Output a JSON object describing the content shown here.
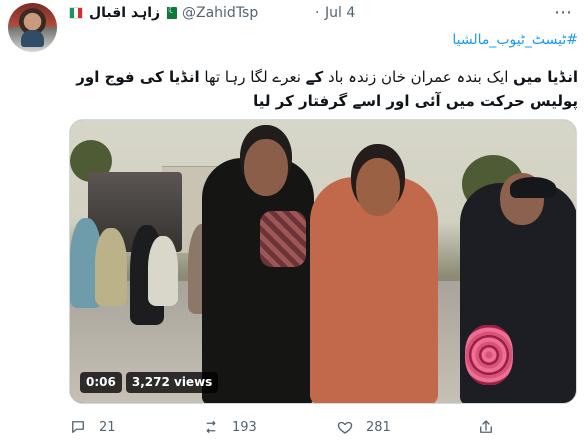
{
  "author": {
    "display_name": "زاہد اقبال",
    "handle": "@ZahidTsp",
    "date": "Jul 4",
    "separator": "·"
  },
  "tweet": {
    "hashtag": "#ٹیسٹ_ٹیوب_مالشیا",
    "line1_prefix": "انڈیا میں",
    "line1_middle": " ایک بندہ عمران خان زندہ باد ",
    "line1_ke": "کے",
    "line1_suffix": " نعرے لگا رہا تھا ",
    "line1_bold_end": "انڈیا کی فوج اور",
    "line2": "پولیس حرکت میں آئی اور اسے گرفتار کر لیا"
  },
  "video": {
    "duration": "0:06",
    "views": "3,272 views"
  },
  "actions": {
    "replies": "21",
    "retweets": "193",
    "likes": "281"
  },
  "colors": {
    "link": "#1d9bf0",
    "muted": "#536471"
  },
  "icons": [
    "italy-flag-icon",
    "pakistan-flag-icon",
    "more-icon",
    "reply-icon",
    "retweet-icon",
    "like-icon",
    "share-icon"
  ]
}
